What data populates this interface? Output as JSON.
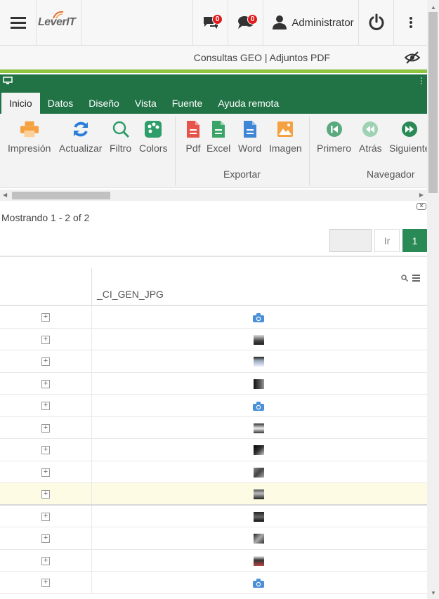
{
  "topbar": {
    "logo_text": "LeverIT",
    "chat_badge": "0",
    "messages_badge": "0",
    "user_name": "Administrator"
  },
  "breadcrumb": "Consultas GEO | Adjuntos PDF",
  "ribbon": {
    "tabs": [
      "Inicio",
      "Datos",
      "Diseño",
      "Vista",
      "Fuente",
      "Ayuda remota"
    ],
    "active_tab": "Inicio",
    "buttons": {
      "print": "Impresión",
      "refresh": "Actualizar",
      "filter": "Filtro",
      "colors": "Colors",
      "pdf": "Pdf",
      "excel": "Excel",
      "word": "Word",
      "image": "Imagen",
      "first": "Primero",
      "back": "Atrás",
      "next": "Siguiente"
    },
    "groups": {
      "export": "Exportar",
      "navigator": "Navegador"
    },
    "colors": {
      "header_green": "#217346",
      "accent_line": "#8cc63f"
    }
  },
  "grid": {
    "showing": "Mostrando 1 - 2 of 2",
    "go_label": "Ir",
    "current_page": "1",
    "column": "_CI_GEN_JPG",
    "rows": [
      {
        "kind": "camera-icon"
      },
      {
        "kind": "photo-thumbnail"
      },
      {
        "kind": "photo-thumbnail"
      },
      {
        "kind": "photo-thumbnail"
      },
      {
        "kind": "camera-icon"
      },
      {
        "kind": "photo-thumbnail"
      },
      {
        "kind": "photo-thumbnail"
      },
      {
        "kind": "photo-thumbnail"
      },
      {
        "kind": "photo-thumbnail",
        "highlighted": true
      },
      {
        "kind": "photo-thumbnail"
      },
      {
        "kind": "photo-thumbnail"
      },
      {
        "kind": "photo-thumbnail"
      },
      {
        "kind": "camera-icon"
      }
    ]
  }
}
